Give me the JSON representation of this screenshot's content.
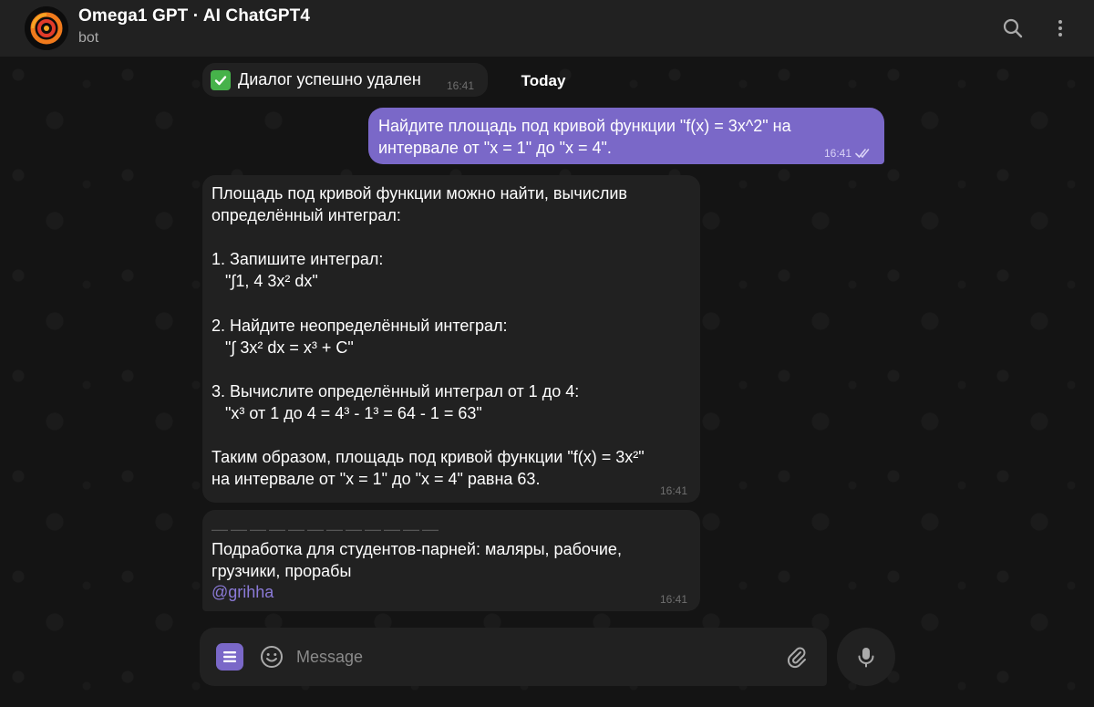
{
  "header": {
    "title": "Omega1 GPT · AI ChatGPT4",
    "subtitle": "bot"
  },
  "chat": {
    "date_label": "Today",
    "service": {
      "text": "Диалог успешно удален",
      "time": "16:41"
    },
    "outgoing": {
      "text": "Найдите площадь под кривой функции \"f(x) = 3x^2\" на интервале от \"x = 1\" до \"x = 4\".",
      "time": "16:41",
      "status": "read"
    },
    "incoming": [
      {
        "text": "Площадь под кривой функции можно найти, вычислив\nопределённый интеграл:\n\n1. Запишите интеграл:\n   \"∫1, 4 3x² dx\"\n\n2. Найдите неопределённый интеграл:\n   \"∫ 3x² dx = x³ + C\"\n\n3. Вычислите определённый интеграл от 1 до 4:\n   \"x³ от 1 до 4 = 4³ - 1³ = 64 - 1 = 63\"\n\nТаким образом, площадь под кривой функции \"f(x) = 3x²\"\nна интервале от \"x = 1\" до \"x = 4\" равна 63.",
        "time": "16:41"
      },
      {
        "divider": "— — — — — — — — — — — —",
        "text": "Подработка для студентов-парней: маляры, рабочие,\nгрузчики, прорабы",
        "link": "@grihha",
        "time": "16:41"
      }
    ]
  },
  "composer": {
    "placeholder": "Message",
    "value": ""
  },
  "colors": {
    "accent": "#7a68c8",
    "bubble_in": "#212121",
    "background": "#141414",
    "link": "#8b7ad8",
    "check_green": "#46b24a"
  },
  "icons": {
    "avatar": "omega-spiral-logo",
    "search": "search-icon",
    "more": "more-vertical-icon",
    "menu": "bot-menu-icon",
    "emoji": "smile-icon",
    "attach": "paperclip-icon",
    "mic": "microphone-icon",
    "read": "double-check-icon",
    "service": "check-mark-icon"
  }
}
